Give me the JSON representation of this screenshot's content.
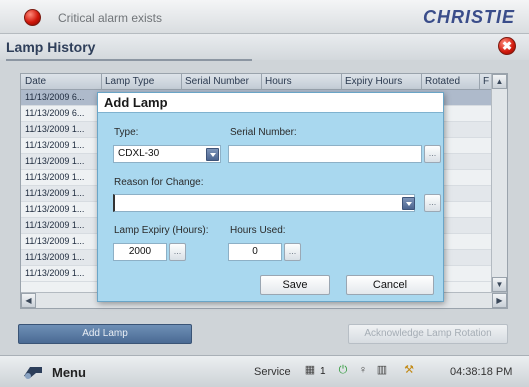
{
  "status_bar": {
    "alarm_text": "Critical alarm exists",
    "brand": "CHRISTIE"
  },
  "page": {
    "title": "Lamp History",
    "close_icon": "close-icon",
    "close_glyph": "✖"
  },
  "table": {
    "columns": [
      "Date",
      "Lamp Type",
      "Serial Number",
      "Hours",
      "Expiry Hours",
      "Rotated",
      "F"
    ],
    "rows": [
      "11/13/2009 6...",
      "11/13/2009 6...",
      "11/13/2009 1...",
      "11/13/2009 1...",
      "11/13/2009 1...",
      "11/13/2009 1...",
      "11/13/2009 1...",
      "11/13/2009 1...",
      "11/13/2009 1...",
      "11/13/2009 1...",
      "11/13/2009 1...",
      "11/13/2009 1..."
    ]
  },
  "buttons": {
    "add_lamp": "Add Lamp",
    "acknowledge": "Acknowledge Lamp Rotation"
  },
  "dialog": {
    "title": "Add Lamp",
    "type_label": "Type:",
    "type_value": "CDXL-30",
    "serial_label": "Serial Number:",
    "serial_value": "",
    "reason_label": "Reason for Change:",
    "reason_value": "",
    "expiry_label": "Lamp Expiry (Hours):",
    "expiry_value": "2000",
    "hours_used_label": "Hours Used:",
    "hours_used_value": "0",
    "ellipsis": "...",
    "save": "Save",
    "cancel": "Cancel"
  },
  "bottom_bar": {
    "menu": "Menu",
    "service": "Service",
    "channel": "1",
    "clock": "04:38:18 PM"
  },
  "colors": {
    "dialog_bg": "#a9d8ef",
    "brand": "#3a4d8a",
    "alarm": "#d0160a"
  }
}
